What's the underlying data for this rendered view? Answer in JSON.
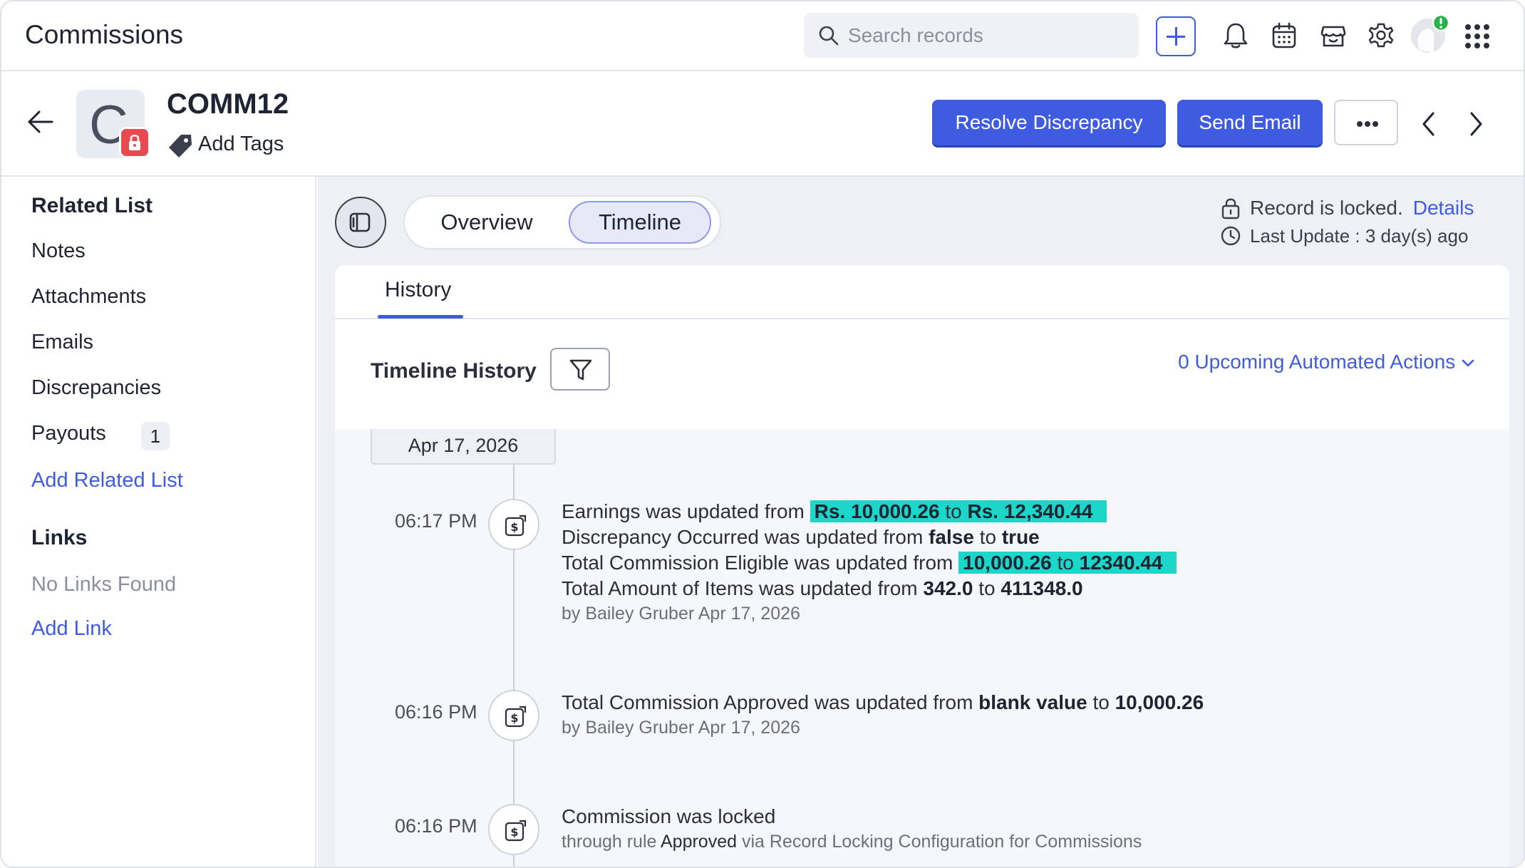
{
  "app": {
    "title": "Commissions"
  },
  "search": {
    "placeholder": "Search records"
  },
  "icons": {
    "add": "plus-icon",
    "notifications": "bell-icon",
    "calendar": "calendar-icon",
    "marketplace": "store-icon",
    "settings": "gear-icon",
    "apps": "grid-icon"
  },
  "record": {
    "avatar_letter": "C",
    "name": "COMM12",
    "add_tags": "Add Tags",
    "actions": {
      "resolve": "Resolve Discrepancy",
      "send_email": "Send Email"
    }
  },
  "sidebar": {
    "related_heading": "Related List",
    "items": [
      {
        "label": "Notes"
      },
      {
        "label": "Attachments"
      },
      {
        "label": "Emails"
      },
      {
        "label": "Discrepancies"
      },
      {
        "label": "Payouts",
        "count": "1"
      }
    ],
    "add_related": "Add Related List",
    "links_heading": "Links",
    "no_links": "No Links Found",
    "add_link": "Add Link"
  },
  "view_tabs": [
    {
      "label": "Overview"
    },
    {
      "label": "Timeline",
      "active": true
    }
  ],
  "lock_info": {
    "locked_text": "Record is locked.",
    "details_link": "Details",
    "last_update": "Last Update : 3 day(s) ago"
  },
  "history": {
    "tab_label": "History",
    "title": "Timeline History",
    "upcoming": "0 Upcoming Automated Actions",
    "date": "Apr 17, 2026",
    "entries": [
      {
        "time": "06:17 PM",
        "lines": [
          {
            "prefix": "Earnings was updated from ",
            "from": "Rs. 10,000.26",
            "to": "Rs. 12,340.44",
            "highlight": true
          },
          {
            "prefix": "Discrepancy Occurred was updated from ",
            "from": "false",
            "to": "true",
            "highlight": false
          },
          {
            "prefix": "Total Commission Eligible was updated from ",
            "from": "10,000.26",
            "to": "12340.44",
            "highlight": true
          },
          {
            "prefix": "Total Amount of Items was updated from ",
            "from": "342.0",
            "to": "411348.0",
            "highlight": false
          }
        ],
        "by": "by Bailey Gruber Apr 17, 2026"
      },
      {
        "time": "06:16 PM",
        "lines": [
          {
            "prefix": "Total Commission Approved was updated from ",
            "from": "blank value",
            "to": "10,000.26",
            "highlight": false
          }
        ],
        "by": "by Bailey Gruber Apr 17, 2026"
      },
      {
        "time": "06:16 PM",
        "text": "Commission was locked",
        "rule_prefix": "through rule ",
        "rule_name": "Approved",
        "rule_suffix": " via Record Locking Configuration for Commissions"
      }
    ],
    "connector": "to"
  },
  "colors": {
    "accent": "#3f5be0",
    "highlight": "#1bd6c9",
    "lock_badge": "#e84a4f",
    "main_bg": "#eef0f6"
  }
}
